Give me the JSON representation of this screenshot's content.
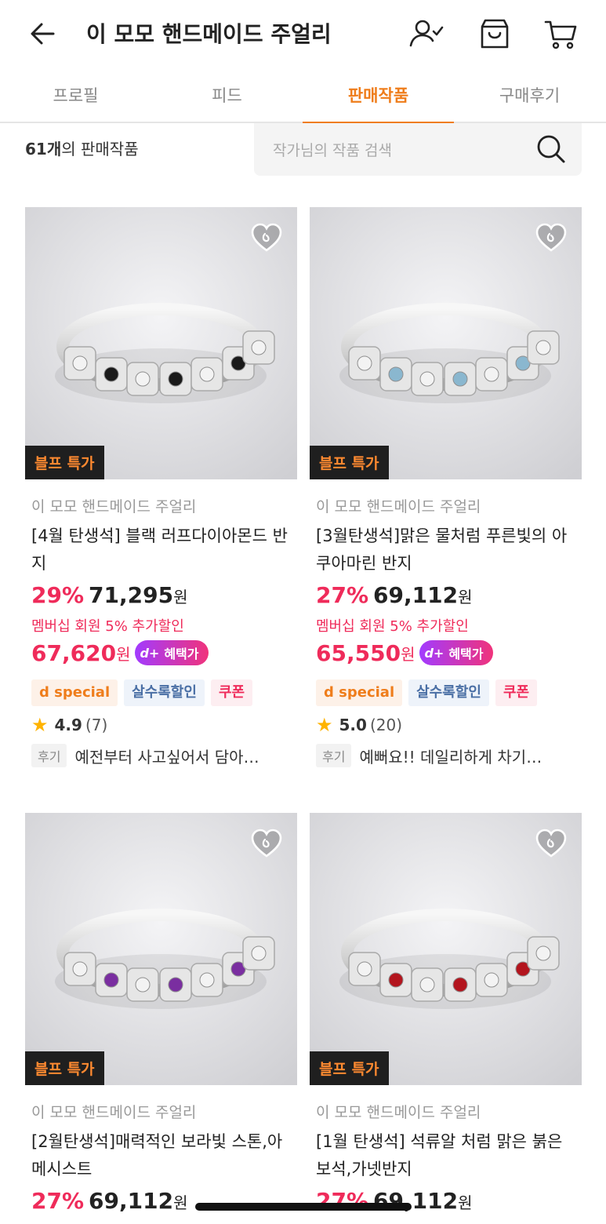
{
  "header": {
    "title": "이 모모 핸드메이드 주얼리",
    "icons": [
      "back-arrow-icon",
      "follow-user-icon",
      "store-icon",
      "cart-icon"
    ]
  },
  "tabs": [
    {
      "label": "프로필",
      "active": false
    },
    {
      "label": "피드",
      "active": false
    },
    {
      "label": "판매작품",
      "active": true
    },
    {
      "label": "구매후기",
      "active": false
    }
  ],
  "listing": {
    "count": "61개",
    "count_suffix": "의 판매작품",
    "search_placeholder": "작가님의 작품 검색"
  },
  "colors": {
    "accent": "#ef7d1b",
    "discount": "#ef2b5a",
    "badge_bg": "#1f1f1f"
  },
  "products": [
    {
      "badge": "블프 특가",
      "seller": "이 모모 핸드메이드 주얼리",
      "name": "[4월 탄생석] 블랙 러프다이아몬드 반지",
      "discount": "29%",
      "price": "71,295",
      "won": "원",
      "member_note": "멤버십 회원 5% 추가할인",
      "member_price": "67,620",
      "benefit": "혜택가",
      "tags": [
        "special",
        "살수록할인",
        "쿠폰"
      ],
      "rating": "4.9",
      "reviews": "(7)",
      "review_label": "후기",
      "review_text": "예전부터 사고싶어서 담아…",
      "stone": "#1a1a1a"
    },
    {
      "badge": "블프 특가",
      "seller": "이 모모 핸드메이드 주얼리",
      "name": "[3월탄생석]맑은 물처럼 푸른빛의 아쿠아마린 반지",
      "discount": "27%",
      "price": "69,112",
      "won": "원",
      "member_note": "멤버십 회원 5% 추가할인",
      "member_price": "65,550",
      "benefit": "혜택가",
      "tags": [
        "special",
        "살수록할인",
        "쿠폰"
      ],
      "rating": "5.0",
      "reviews": "(20)",
      "review_label": "후기",
      "review_text": "예뻐요!! 데일리하게 차기…",
      "stone": "#8ab7cf"
    },
    {
      "badge": "블프 특가",
      "seller": "이 모모 핸드메이드 주얼리",
      "name": "[2월탄생석]매력적인 보라빛 스톤,아메시스트",
      "discount": "27%",
      "price": "69,112",
      "won": "원",
      "stone": "#7a2ea0"
    },
    {
      "badge": "블프 특가",
      "seller": "이 모모 핸드메이드 주얼리",
      "name": "[1월 탄생석] 석류알 처럼 맑은 붉은 보석,가넷반지",
      "discount": "27%",
      "price": "69,112",
      "won": "원",
      "stone": "#b3151e"
    }
  ]
}
